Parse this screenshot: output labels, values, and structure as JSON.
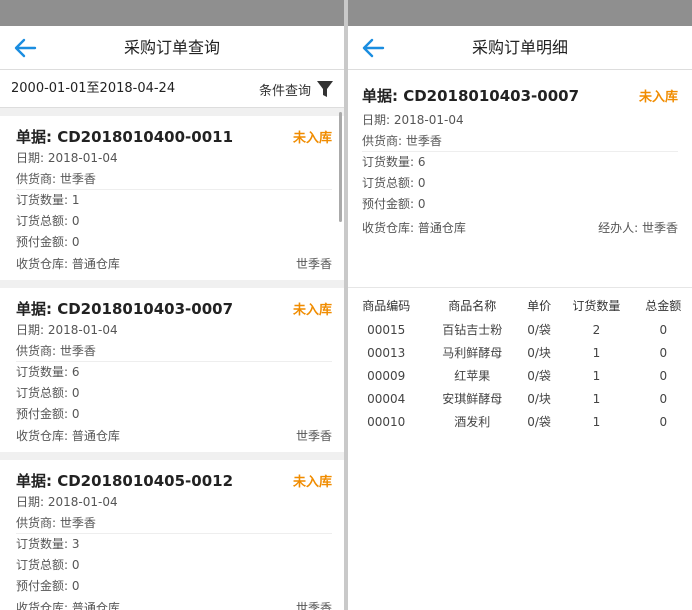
{
  "left": {
    "title": "采购订单查询",
    "date_range": "2000-01-01至2018-04-24",
    "filter_label": "条件查询",
    "orders": [
      {
        "no": "单据: CD2018010400-0011",
        "status": "未入库",
        "date": "日期: 2018-01-04",
        "supplier": "供货商: 世季香",
        "qty": "订货数量: 1",
        "total": "订货总额: 0",
        "prepaid": "预付金额: 0",
        "warehouse": "收货仓库: 普通仓库",
        "handler": "世季香"
      },
      {
        "no": "单据: CD2018010403-0007",
        "status": "未入库",
        "date": "日期: 2018-01-04",
        "supplier": "供货商: 世季香",
        "qty": "订货数量: 6",
        "total": "订货总额: 0",
        "prepaid": "预付金额: 0",
        "warehouse": "收货仓库: 普通仓库",
        "handler": "世季香"
      },
      {
        "no": "单据: CD2018010405-0012",
        "status": "未入库",
        "date": "日期: 2018-01-04",
        "supplier": "供货商: 世季香",
        "qty": "订货数量: 3",
        "total": "订货总额: 0",
        "prepaid": "预付金额: 0",
        "warehouse": "收货仓库: 普通仓库",
        "handler": "世季香"
      }
    ]
  },
  "right": {
    "title": "采购订单明细",
    "order_no": "单据: CD2018010403-0007",
    "status": "未入库",
    "date": "日期: 2018-01-04",
    "supplier": "供货商: 世季香",
    "qty": "订货数量: 6",
    "total": "订货总额: 0",
    "prepaid": "预付金额: 0",
    "warehouse": "收货仓库: 普通仓库",
    "handler": "经办人: 世季香",
    "columns": [
      "商品编码",
      "商品名称",
      "单价",
      "订货数量",
      "总金额"
    ],
    "rows": [
      [
        "00015",
        "百钻吉士粉",
        "0/袋",
        "2",
        "0"
      ],
      [
        "00013",
        "马利鲜酵母",
        "0/块",
        "1",
        "0"
      ],
      [
        "00009",
        "红苹果",
        "0/袋",
        "1",
        "0"
      ],
      [
        "00004",
        "安琪鲜酵母",
        "0/块",
        "1",
        "0"
      ],
      [
        "00010",
        "酒发利",
        "0/袋",
        "1",
        "0"
      ]
    ]
  },
  "colors": {
    "accent": "#1a8de0",
    "status": "#f08c00"
  }
}
